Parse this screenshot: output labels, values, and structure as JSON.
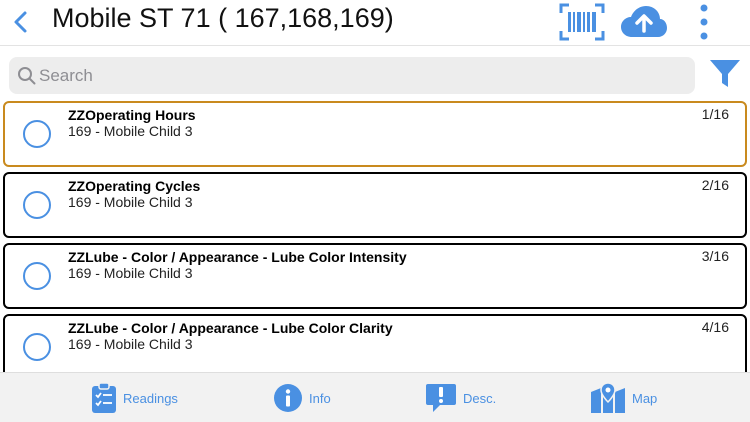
{
  "header": {
    "title": "Mobile ST 71 ( 167,168,169)",
    "accent": "#4a90e2",
    "icons": [
      "chevron-left-icon",
      "barcode-scan-icon",
      "cloud-upload-icon",
      "more-vertical-icon"
    ]
  },
  "search": {
    "placeholder": "Search",
    "value": ""
  },
  "items": [
    {
      "title": "ZZOperating Hours",
      "subtitle": "169 - Mobile Child 3",
      "count": "1/16",
      "selected": true
    },
    {
      "title": "ZZOperating Cycles",
      "subtitle": "169 - Mobile Child 3",
      "count": "2/16",
      "selected": false
    },
    {
      "title": "ZZLube - Color / Appearance - Lube Color Intensity",
      "subtitle": "169 - Mobile Child 3",
      "count": "3/16",
      "selected": false
    },
    {
      "title": "ZZLube - Color / Appearance - Lube Color Clarity",
      "subtitle": "169 - Mobile Child 3",
      "count": "4/16",
      "selected": false
    }
  ],
  "tabs": [
    {
      "label": "Readings",
      "icon": "clipboard-checklist-icon"
    },
    {
      "label": "Info",
      "icon": "info-icon"
    },
    {
      "label": "Desc.",
      "icon": "speech-bubble-alert-icon"
    },
    {
      "label": "Map",
      "icon": "map-pin-icon"
    }
  ],
  "colors": {
    "selected_border": "#c98a1e",
    "item_border": "#000000",
    "radio": "#4a90e2"
  }
}
